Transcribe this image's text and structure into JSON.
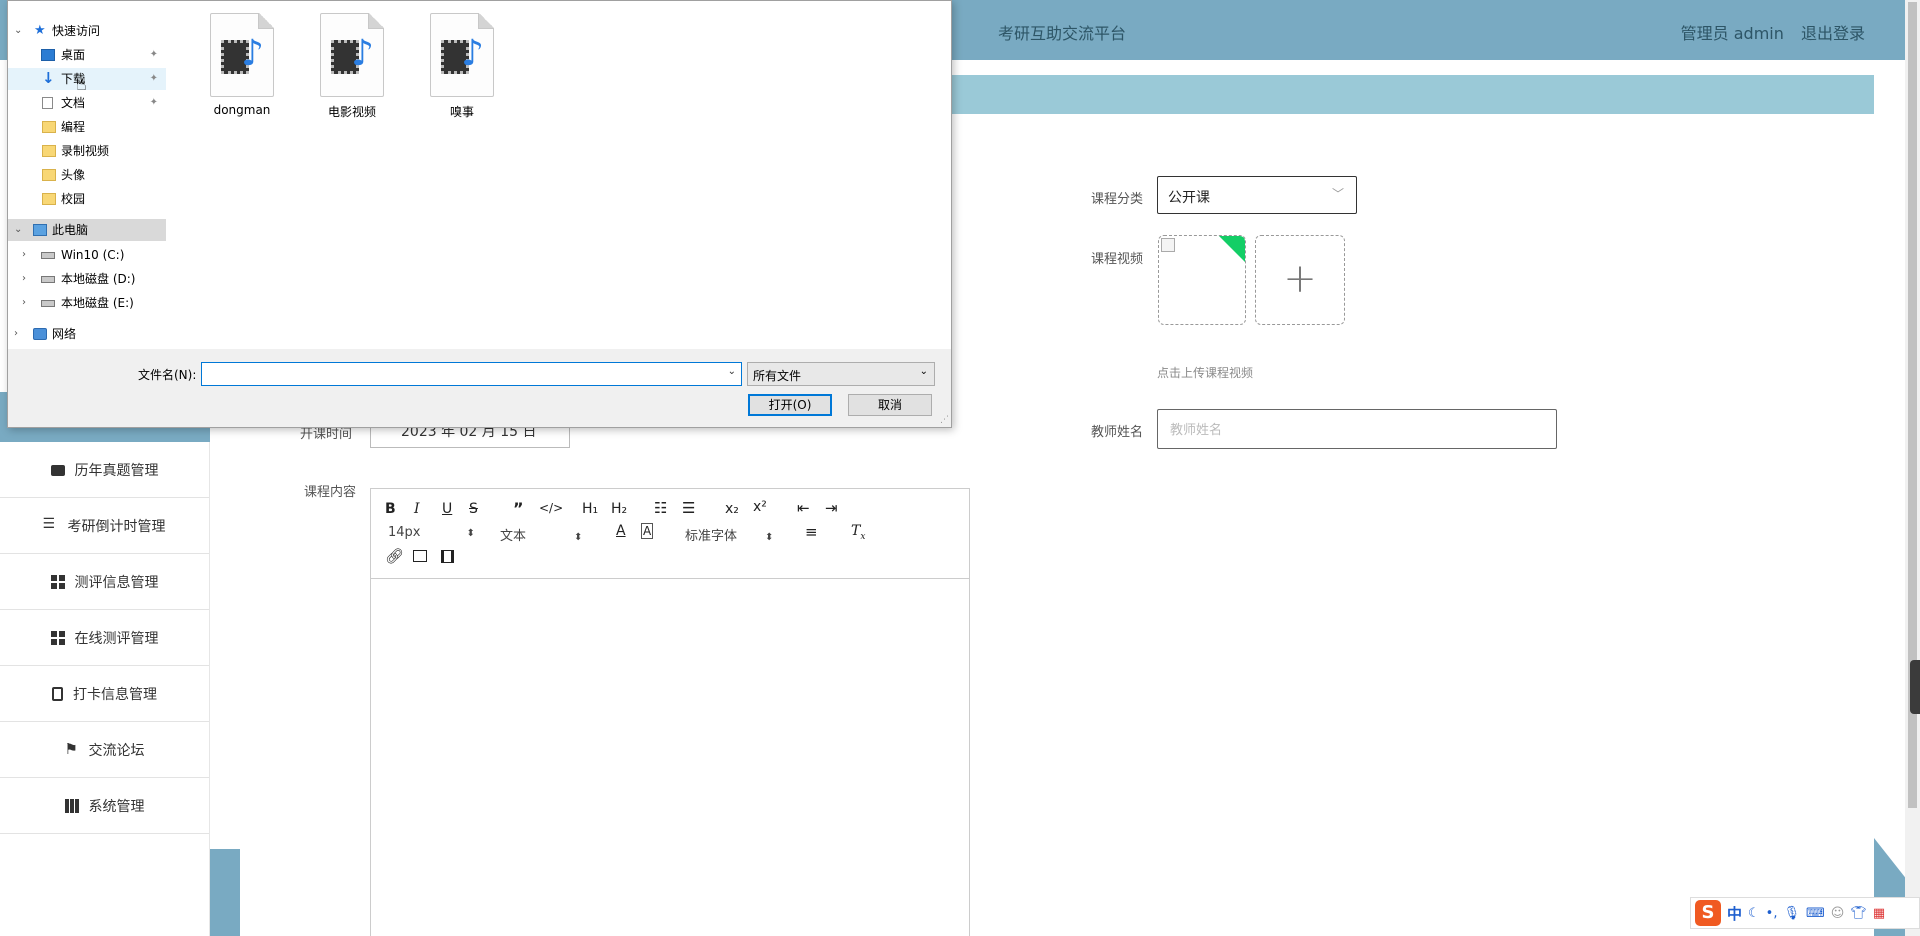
{
  "header": {
    "site_title": "考研互助交流平台",
    "user_label": "管理员 admin",
    "logout_label": "退出登录"
  },
  "sidebar": {
    "items": [
      {
        "label": "历年真题管理",
        "icon": "wallet-icon"
      },
      {
        "label": "考研倒计时管理",
        "icon": "list-icon"
      },
      {
        "label": "测评信息管理",
        "icon": "grid-icon"
      },
      {
        "label": "在线测评管理",
        "icon": "grid-icon"
      },
      {
        "label": "打卡信息管理",
        "icon": "clipboard-icon"
      },
      {
        "label": "交流论坛",
        "icon": "flag-icon"
      },
      {
        "label": "系统管理",
        "icon": "book-icon"
      }
    ]
  },
  "form": {
    "start_time_label": "开课时间",
    "start_time_value": "2023 年 02 月 15 日",
    "category_label": "课程分类",
    "category_value": "公开课",
    "video_label": "课程视频",
    "upload_tip": "点击上传课程视频",
    "teacher_label": "教师姓名",
    "teacher_placeholder": "教师姓名",
    "content_label": "课程内容"
  },
  "editor": {
    "font_size": "14px",
    "paragraph": "文本",
    "font_family": "标准字体",
    "h1": "H₁",
    "h2": "H₂"
  },
  "dialog": {
    "nav": {
      "quick_access": "快速访问",
      "desktop": "桌面",
      "downloads": "下载",
      "documents": "文档",
      "programming": "编程",
      "recordings": "录制视频",
      "avatar": "头像",
      "campus": "校园",
      "this_pc": "此电脑",
      "drive_c": "Win10 (C:)",
      "drive_d": "本地磁盘 (D:)",
      "drive_e": "本地磁盘 (E:)",
      "network": "网络"
    },
    "files": [
      {
        "name": "dongman"
      },
      {
        "name": "电影视频"
      },
      {
        "name": "嗅事"
      }
    ],
    "filename_label": "文件名(N):",
    "filename_value": "",
    "filetype_value": "所有文件",
    "open_label": "打开(O)",
    "cancel_label": "取消"
  },
  "ime": {
    "logo": "S",
    "mode": "中"
  },
  "colors": {
    "header": "#79aac2",
    "breadcrumb": "#9ac9d7",
    "accent": "#0078d7",
    "success": "#13ce66"
  }
}
